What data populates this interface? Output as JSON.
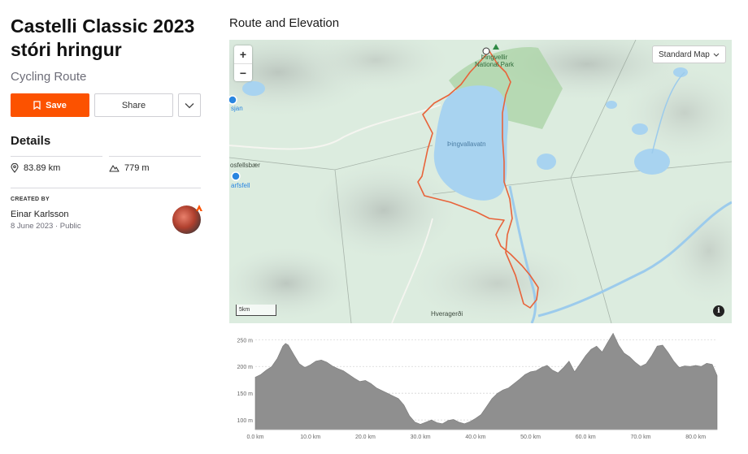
{
  "route": {
    "title_line1": "Castelli Classic 2023",
    "title_line2": "stóri hringur",
    "type": "Cycling Route"
  },
  "actions": {
    "save_label": "Save",
    "share_label": "Share"
  },
  "details": {
    "heading": "Details",
    "distance": "83.89 km",
    "elevation_gain": "779 m"
  },
  "creator": {
    "label": "CREATED BY",
    "name": "Einar Karlsson",
    "date": "8 June 2023",
    "visibility": "Public"
  },
  "map": {
    "section_title": "Route and Elevation",
    "style_selector": "Standard Map",
    "zoom_in": "+",
    "zoom_out": "−",
    "scale": "5km",
    "info": "i",
    "labels": {
      "park_line1": "Þingvellir",
      "park_line2": "National Park",
      "lake": "Þingvallavatn",
      "town_south": "Hveragerði",
      "town_west1": "osfellsbær",
      "poi_west1": "sjan",
      "poi_west2": "arfsfell"
    }
  },
  "colors": {
    "brand": "#fc5200",
    "route": "#e8633a",
    "elevation_fill": "#8f8f8f"
  },
  "chart_data": {
    "type": "area",
    "xlabel": "",
    "ylabel": "",
    "x_ticks": [
      "0.0 km",
      "10.0 km",
      "20.0 km",
      "30.0 km",
      "40.0 km",
      "50.0 km",
      "60.0 km",
      "70.0 km",
      "80.0 km"
    ],
    "y_ticks": [
      "100 m",
      "150 m",
      "200 m",
      "250 m"
    ],
    "xlim": [
      0,
      83.89
    ],
    "ylim": [
      82,
      258
    ],
    "x": [
      0,
      1,
      2,
      3,
      4,
      5,
      5.5,
      6,
      7,
      8,
      9,
      10,
      11,
      12,
      13,
      14,
      15,
      16,
      17,
      18,
      19,
      20,
      21,
      22,
      23,
      24,
      25,
      26,
      27,
      28,
      29,
      30,
      31,
      32,
      33,
      34,
      35,
      36,
      37,
      38,
      39,
      40,
      41,
      42,
      43,
      44,
      45,
      46,
      47,
      48,
      49,
      50,
      51,
      52,
      53,
      54,
      55,
      56,
      57,
      58,
      59,
      60,
      61,
      62,
      63,
      64,
      65,
      66,
      67,
      68,
      69,
      70,
      71,
      72,
      73,
      74,
      75,
      76,
      77,
      78,
      79,
      80,
      81,
      82,
      83,
      83.89
    ],
    "y": [
      180,
      185,
      193,
      200,
      215,
      238,
      243,
      240,
      222,
      205,
      198,
      203,
      210,
      212,
      208,
      201,
      196,
      192,
      185,
      178,
      172,
      174,
      168,
      160,
      155,
      150,
      145,
      140,
      128,
      108,
      96,
      92,
      96,
      100,
      95,
      93,
      99,
      101,
      96,
      93,
      97,
      103,
      110,
      125,
      140,
      150,
      156,
      160,
      168,
      176,
      185,
      190,
      192,
      198,
      202,
      193,
      188,
      198,
      210,
      190,
      205,
      220,
      232,
      238,
      227,
      245,
      262,
      240,
      225,
      218,
      208,
      200,
      205,
      220,
      238,
      240,
      226,
      210,
      198,
      201,
      200,
      202,
      200,
      206,
      204,
      183
    ]
  }
}
